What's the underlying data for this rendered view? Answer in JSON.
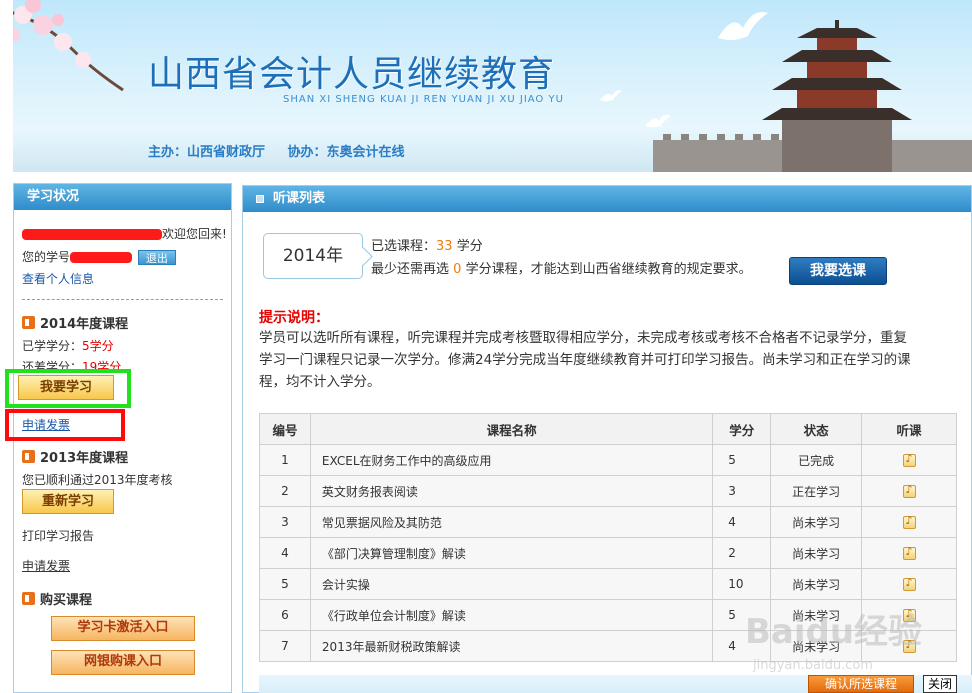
{
  "banner": {
    "title": "山西省会计人员继续教育",
    "pinyin": "SHAN XI SHENG KUAI JI REN YUAN JI XU JIAO YU",
    "host": "主办：山西省财政厅",
    "cohost": "协办：东奥会计在线"
  },
  "sidebar": {
    "header": "学习状况",
    "welcome_suffix": "欢迎您回来!",
    "student_no_label": "您的学号",
    "logout": "退出",
    "profile_link": "查看个人信息",
    "course2014": {
      "title": "2014年度课程",
      "earned_label": "已学学分：",
      "earned_value": "5学分",
      "remaining_label": "还差学分：",
      "remaining_value": "19学分",
      "study_btn": "我要学习",
      "invoice_link": "申请发票"
    },
    "course2013": {
      "title": "2013年度课程",
      "passed_text": "您已顺利通过2013年度考核",
      "restudy_btn": "重新学习",
      "print_report": "打印学习报告",
      "invoice_link": "申请发票"
    },
    "purchase": {
      "title": "购买课程",
      "card_btn": "学习卡激活入口",
      "online_btn": "网银购课入口"
    }
  },
  "main": {
    "header": "听课列表",
    "year": "2014年",
    "selected_label": "已选课程：",
    "selected_value": "33",
    "selected_unit": "学分",
    "need_prefix": "最少还需再选",
    "need_value": "0",
    "need_suffix": "学分课程，才能达到山西省继续教育的规定要求。",
    "select_btn": "我要选课",
    "tip_title": "提示说明：",
    "tip_text": "学员可以选听所有课程，听完课程并完成考核暨取得相应学分，未完成考核或考核不合格者不记录学分，重复学习一门课程只记录一次学分。修满24学分完成当年度继续教育并可打印学习报告。尚未学习和正在学习的课程，均不计入学分。",
    "table": {
      "headers": [
        "编号",
        "课程名称",
        "学分",
        "状态",
        "听课"
      ],
      "rows": [
        {
          "no": "1",
          "name": "EXCEL在财务工作中的高级应用",
          "credit": "5",
          "status": "已完成"
        },
        {
          "no": "2",
          "name": "英文财务报表阅读",
          "credit": "3",
          "status": "正在学习"
        },
        {
          "no": "3",
          "name": "常见票据风险及其防范",
          "credit": "4",
          "status": "尚未学习"
        },
        {
          "no": "4",
          "name": "《部门决算管理制度》解读",
          "credit": "2",
          "status": "尚未学习"
        },
        {
          "no": "5",
          "name": "会计实操",
          "credit": "10",
          "status": "尚未学习"
        },
        {
          "no": "6",
          "name": "《行政单位会计制度》解读",
          "credit": "5",
          "status": "尚未学习"
        },
        {
          "no": "7",
          "name": "2013年最新财税政策解读",
          "credit": "4",
          "status": "尚未学习"
        }
      ]
    },
    "confirm_btn": "确认所选课程",
    "close_btn": "关闭"
  },
  "watermark": {
    "brand": "Baidu经验",
    "url": "jingyan.baidu.com"
  },
  "colors": {
    "header_blue": "#2f8ccb",
    "status_red": "#e60000",
    "highlight_green": "#23e01f",
    "highlight_red": "#ff0a0a"
  }
}
